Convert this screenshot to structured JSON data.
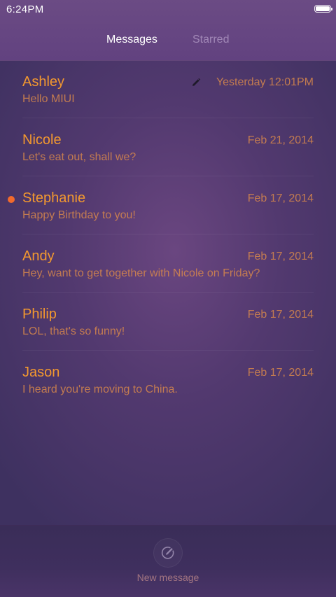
{
  "status_bar": {
    "time": "6:24PM",
    "battery_level": 1.0
  },
  "tabs": [
    {
      "label": "Messages",
      "active": true
    },
    {
      "label": "Starred",
      "active": false
    }
  ],
  "messages": [
    {
      "name": "Ashley",
      "preview": "Hello MIUI",
      "date": "Yesterday 12:01PM",
      "draft": true,
      "unread": false
    },
    {
      "name": "Nicole",
      "preview": "Let's eat out, shall we?",
      "date": "Feb 21, 2014",
      "draft": false,
      "unread": false
    },
    {
      "name": "Stephanie",
      "preview": "Happy Birthday to you!",
      "date": "Feb 17, 2014",
      "draft": false,
      "unread": true
    },
    {
      "name": "Andy",
      "preview": "Hey, want to get together with Nicole on Friday?",
      "date": "Feb 17, 2014",
      "draft": false,
      "unread": false
    },
    {
      "name": "Philip",
      "preview": "LOL, that's so funny!",
      "date": "Feb 17, 2014",
      "draft": false,
      "unread": false
    },
    {
      "name": "Jason",
      "preview": "I heard you're moving to China.",
      "date": "Feb 17, 2014",
      "draft": false,
      "unread": false
    }
  ],
  "footer": {
    "compose_label": "New message",
    "compose_icon": "compose-icon"
  },
  "colors": {
    "accent": "#f2982f",
    "unread": "#f26a2c",
    "header": "#664683",
    "background": "#4b3768"
  }
}
